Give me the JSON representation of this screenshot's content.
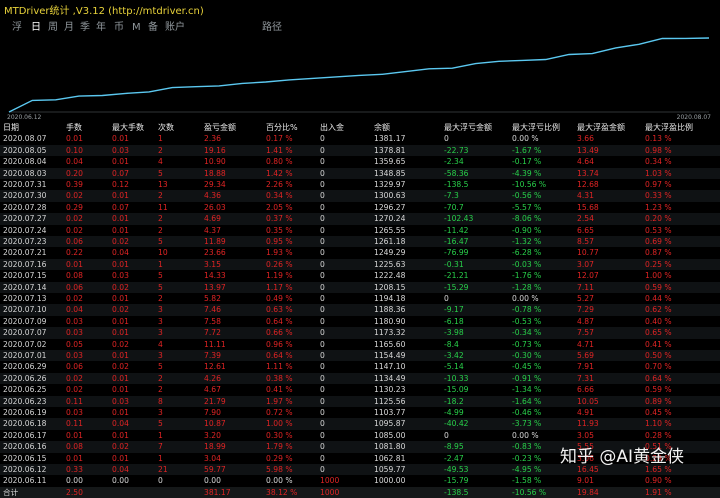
{
  "window": {
    "title": "MTDriver统计 ,V3.12 (http://mtdriver.cn)"
  },
  "tabs": [
    {
      "label": "浮",
      "active": false
    },
    {
      "label": "日",
      "active": true
    },
    {
      "label": "周",
      "active": false
    },
    {
      "label": "月",
      "active": false
    },
    {
      "label": "季",
      "active": false
    },
    {
      "label": "年",
      "active": false
    },
    {
      "label": "币",
      "active": false
    },
    {
      "label": "M",
      "active": false
    },
    {
      "label": "备",
      "active": false
    },
    {
      "label": "账户",
      "active": false
    },
    {
      "label": "路径",
      "active": false
    }
  ],
  "chart_data": {
    "type": "line",
    "x_start": "2020.06.12",
    "x_end": "2020.08.07",
    "values": [
      1000.0,
      1059.77,
      1062.81,
      1081.8,
      1085.0,
      1095.87,
      1103.77,
      1125.58,
      1130.23,
      1134.49,
      1147.1,
      1154.49,
      1165.6,
      1173.32,
      1180.9,
      1188.36,
      1194.18,
      1208.15,
      1222.48,
      1225.63,
      1249.29,
      1261.18,
      1265.55,
      1270.24,
      1296.27,
      1300.63,
      1329.97,
      1348.85,
      1378.81,
      1379.21,
      1381.17
    ],
    "color": "#5bc8f0"
  },
  "table": {
    "headers": [
      "日期",
      "手数",
      "最大手数",
      "次数",
      "盈亏金额",
      "百分比%",
      "出入金",
      "余额",
      "最大浮亏金额",
      "最大浮亏比例",
      "最大浮盈金额",
      "最大浮盈比例"
    ],
    "rows": [
      [
        "2020.08.07",
        "0.01",
        "0.01",
        "1",
        "2.36",
        "0.17 %",
        "0",
        "1381.17",
        "0",
        "0.00 %",
        "3.66",
        "0.13 %"
      ],
      [
        "2020.08.05",
        "0.10",
        "0.03",
        "2",
        "19.16",
        "1.41 %",
        "0",
        "1378.81",
        "-22.73",
        "-1.67 %",
        "13.49",
        "0.98 %"
      ],
      [
        "2020.08.04",
        "0.04",
        "0.01",
        "4",
        "10.90",
        "0.80 %",
        "0",
        "1359.65",
        "-2.34",
        "-0.17 %",
        "4.64",
        "0.34 %"
      ],
      [
        "2020.08.03",
        "0.20",
        "0.07",
        "5",
        "18.88",
        "1.42 %",
        "0",
        "1348.85",
        "-58.36",
        "-4.39 %",
        "13.74",
        "1.03 %"
      ],
      [
        "2020.07.31",
        "0.39",
        "0.12",
        "13",
        "29.34",
        "2.26 %",
        "0",
        "1329.97",
        "-138.5",
        "-10.56 %",
        "12.68",
        "0.97 %"
      ],
      [
        "2020.07.30",
        "0.02",
        "0.01",
        "2",
        "4.36",
        "0.34 %",
        "0",
        "1300.63",
        "-7.3",
        "-0.56 %",
        "4.31",
        "0.33 %"
      ],
      [
        "2020.07.28",
        "0.29",
        "0.07",
        "11",
        "26.03",
        "2.05 %",
        "0",
        "1296.27",
        "-70.7",
        "-5.57 %",
        "15.68",
        "1.23 %"
      ],
      [
        "2020.07.27",
        "0.02",
        "0.01",
        "2",
        "4.69",
        "0.37 %",
        "0",
        "1270.24",
        "-102.43",
        "-8.06 %",
        "2.54",
        "0.20 %"
      ],
      [
        "2020.07.24",
        "0.02",
        "0.01",
        "2",
        "4.37",
        "0.35 %",
        "0",
        "1265.55",
        "-11.42",
        "-0.90 %",
        "6.65",
        "0.53 %"
      ],
      [
        "2020.07.23",
        "0.06",
        "0.02",
        "5",
        "11.89",
        "0.95 %",
        "0",
        "1261.18",
        "-16.47",
        "-1.32 %",
        "8.57",
        "0.69 %"
      ],
      [
        "2020.07.21",
        "0.22",
        "0.04",
        "10",
        "23.66",
        "1.93 %",
        "0",
        "1249.29",
        "-76.99",
        "-6.28 %",
        "10.77",
        "0.87 %"
      ],
      [
        "2020.07.16",
        "0.01",
        "0.01",
        "1",
        "3.15",
        "0.26 %",
        "0",
        "1225.63",
        "-0.31",
        "-0.03 %",
        "3.07",
        "0.25 %"
      ],
      [
        "2020.07.15",
        "0.08",
        "0.03",
        "5",
        "14.33",
        "1.19 %",
        "0",
        "1222.48",
        "-21.21",
        "-1.76 %",
        "12.07",
        "1.00 %"
      ],
      [
        "2020.07.14",
        "0.06",
        "0.02",
        "5",
        "13.97",
        "1.17 %",
        "0",
        "1208.15",
        "-15.29",
        "-1.28 %",
        "7.11",
        "0.59 %"
      ],
      [
        "2020.07.13",
        "0.02",
        "0.01",
        "2",
        "5.82",
        "0.49 %",
        "0",
        "1194.18",
        "0",
        "0.00 %",
        "5.27",
        "0.44 %"
      ],
      [
        "2020.07.10",
        "0.04",
        "0.02",
        "3",
        "7.46",
        "0.63 %",
        "0",
        "1188.36",
        "-9.17",
        "-0.78 %",
        "7.29",
        "0.62 %"
      ],
      [
        "2020.07.09",
        "0.03",
        "0.01",
        "3",
        "7.58",
        "0.64 %",
        "0",
        "1180.90",
        "-6.18",
        "-0.53 %",
        "4.87",
        "0.40 %"
      ],
      [
        "2020.07.07",
        "0.03",
        "0.01",
        "3",
        "7.72",
        "0.66 %",
        "0",
        "1173.32",
        "-3.98",
        "-0.34 %",
        "7.57",
        "0.65 %"
      ],
      [
        "2020.07.02",
        "0.05",
        "0.02",
        "4",
        "11.11",
        "0.96 %",
        "0",
        "1165.60",
        "-8.4",
        "-0.73 %",
        "4.71",
        "0.41 %"
      ],
      [
        "2020.07.01",
        "0.03",
        "0.01",
        "3",
        "7.39",
        "0.64 %",
        "0",
        "1154.49",
        "-3.42",
        "-0.30 %",
        "5.69",
        "0.50 %"
      ],
      [
        "2020.06.29",
        "0.06",
        "0.02",
        "5",
        "12.61",
        "1.11 %",
        "0",
        "1147.10",
        "-5.14",
        "-0.45 %",
        "7.91",
        "0.70 %"
      ],
      [
        "2020.06.26",
        "0.02",
        "0.01",
        "2",
        "4.26",
        "0.38 %",
        "0",
        "1134.49",
        "-10.33",
        "-0.91 %",
        "7.31",
        "0.64 %"
      ],
      [
        "2020.06.25",
        "0.02",
        "0.01",
        "2",
        "4.67",
        "0.41 %",
        "0",
        "1130.23",
        "-15.09",
        "-1.34 %",
        "6.66",
        "0.59 %"
      ],
      [
        "2020.06.23",
        "0.11",
        "0.03",
        "8",
        "21.79",
        "1.97 %",
        "0",
        "1125.56",
        "-18.2",
        "-1.64 %",
        "10.05",
        "0.89 %"
      ],
      [
        "2020.06.19",
        "0.03",
        "0.01",
        "3",
        "7.90",
        "0.72 %",
        "0",
        "1103.77",
        "-4.99",
        "-0.46 %",
        "4.91",
        "0.45 %"
      ],
      [
        "2020.06.18",
        "0.11",
        "0.04",
        "5",
        "10.87",
        "1.00 %",
        "0",
        "1095.87",
        "-40.42",
        "-3.73 %",
        "11.93",
        "1.10 %"
      ],
      [
        "2020.06.17",
        "0.01",
        "0.01",
        "1",
        "3.20",
        "0.30 %",
        "0",
        "1085.00",
        "0",
        "0.00 %",
        "3.05",
        "0.28 %"
      ],
      [
        "2020.06.16",
        "0.08",
        "0.02",
        "7",
        "18.99",
        "1.79 %",
        "0",
        "1081.80",
        "-8.95",
        "-0.83 %",
        "5.55",
        "0.51 %"
      ],
      [
        "2020.06.15",
        "0.01",
        "0.01",
        "1",
        "3.04",
        "0.29 %",
        "0",
        "1062.81",
        "-2.47",
        "-0.23 %",
        "3.06",
        "0.29 %"
      ],
      [
        "2020.06.12",
        "0.33",
        "0.04",
        "21",
        "59.77",
        "5.98 %",
        "0",
        "1059.77",
        "-49.53",
        "-4.95 %",
        "16.45",
        "1.65 %"
      ],
      [
        "2020.06.11",
        "0.00",
        "0.00",
        "0",
        "0.00",
        "0.00 %",
        "1000",
        "1000.00",
        "-15.79",
        "-1.58 %",
        "9.01",
        "0.90 %"
      ]
    ],
    "total": [
      "合计",
      "2.50",
      "",
      "",
      "381.17",
      "38.12 %",
      "1000",
      "",
      "-138.5",
      "-10.56 %",
      "19.84",
      "1.91 %"
    ]
  },
  "watermark": {
    "text": "知乎 @AI黄金侠"
  }
}
